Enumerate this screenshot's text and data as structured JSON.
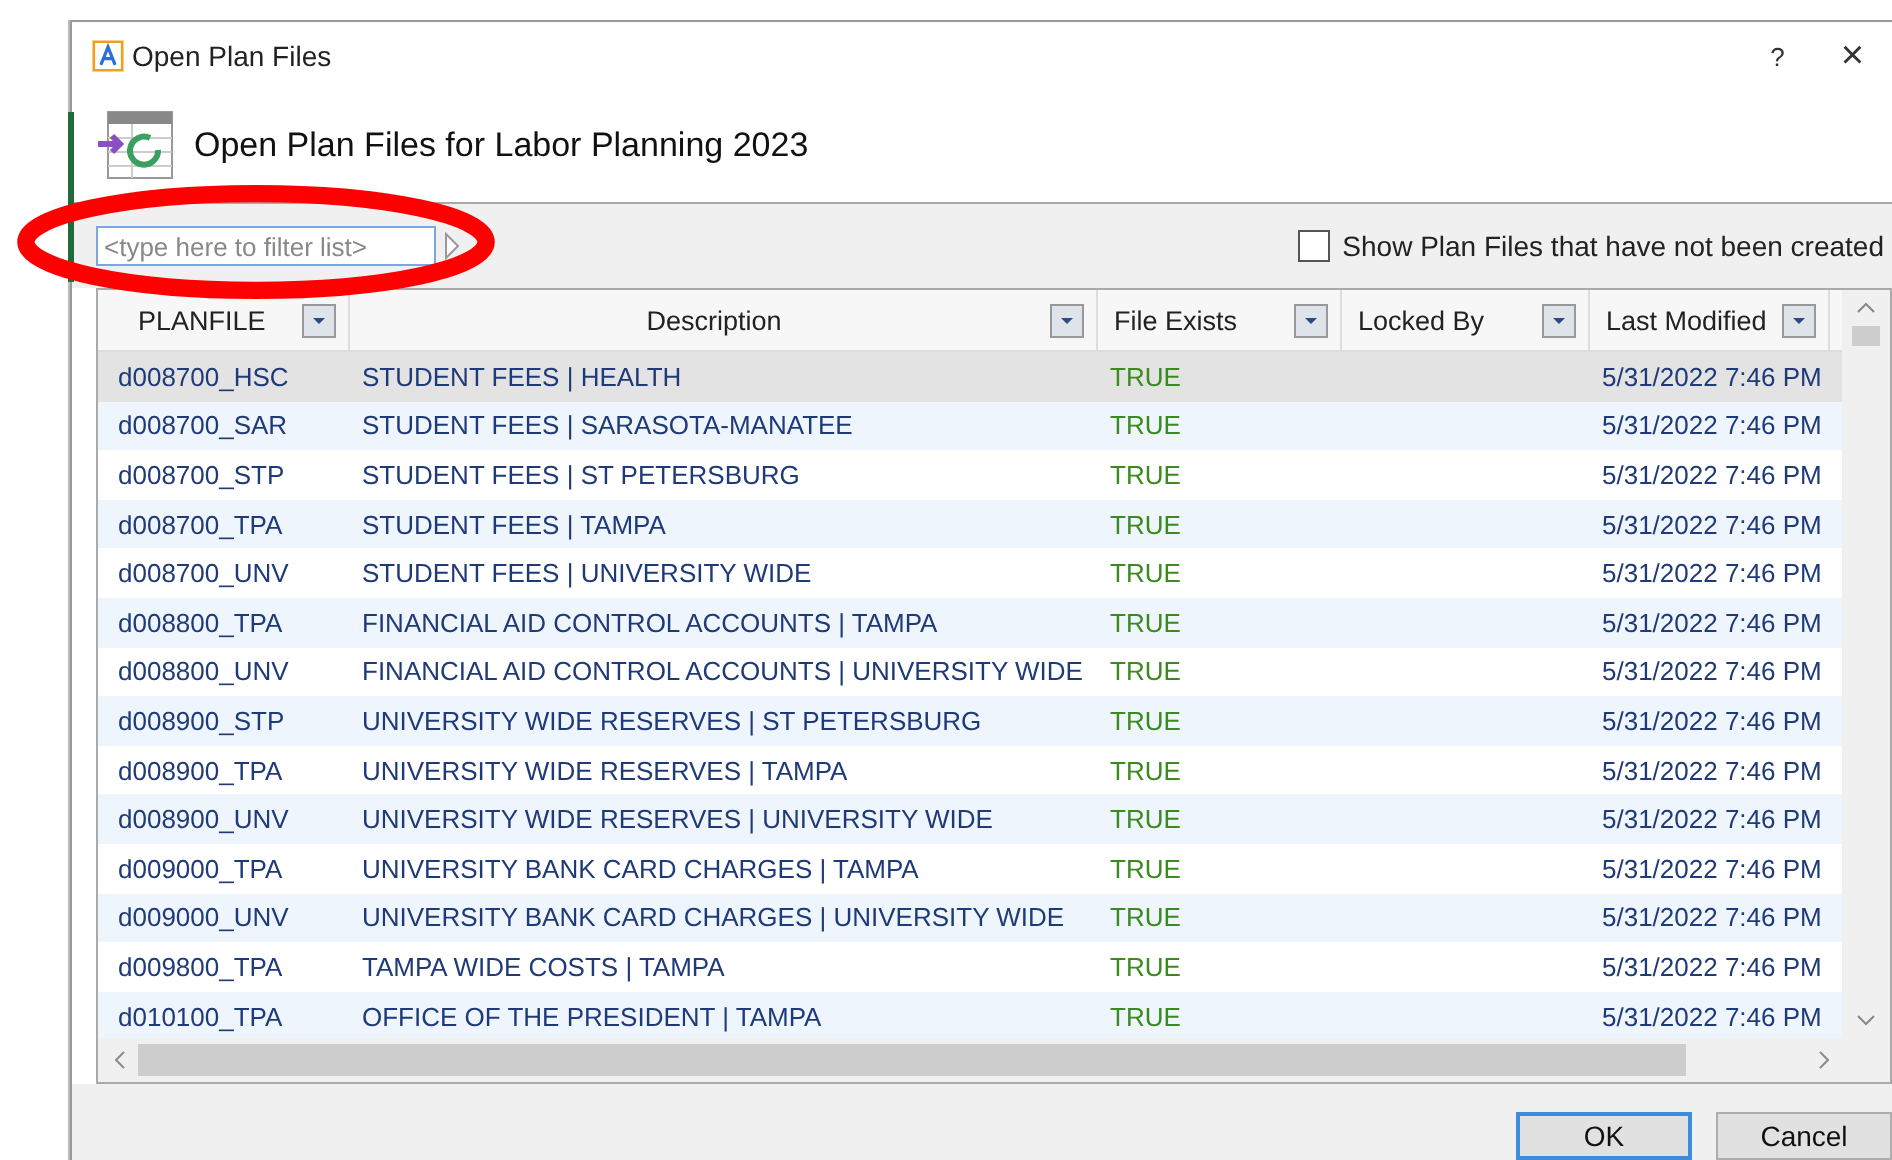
{
  "window": {
    "title": "Open Plan Files",
    "help": "?",
    "close": "×"
  },
  "header": {
    "title": "Open Plan Files for Labor Planning 2023"
  },
  "filter": {
    "placeholder": "<type here to filter list>"
  },
  "show_uncreated": {
    "label": "Show Plan Files that have not been created",
    "checked": false
  },
  "table": {
    "columns": [
      "PLANFILE",
      "Description",
      "File Exists",
      "Locked By",
      "Last Modified"
    ],
    "rows": [
      {
        "planfile": "d008700_HSC",
        "description": "STUDENT FEES | HEALTH",
        "exists": "TRUE",
        "modified": "5/31/2022 7:46 PM",
        "selected": true
      },
      {
        "planfile": "d008700_SAR",
        "description": "STUDENT FEES | SARASOTA-MANATEE",
        "exists": "TRUE",
        "modified": "5/31/2022 7:46 PM",
        "selected": false
      },
      {
        "planfile": "d008700_STP",
        "description": "STUDENT FEES | ST PETERSBURG",
        "exists": "TRUE",
        "modified": "5/31/2022 7:46 PM",
        "selected": false
      },
      {
        "planfile": "d008700_TPA",
        "description": "STUDENT FEES | TAMPA",
        "exists": "TRUE",
        "modified": "5/31/2022 7:46 PM",
        "selected": false
      },
      {
        "planfile": "d008700_UNV",
        "description": "STUDENT FEES | UNIVERSITY WIDE",
        "exists": "TRUE",
        "modified": "5/31/2022 7:46 PM",
        "selected": false
      },
      {
        "planfile": "d008800_TPA",
        "description": "FINANCIAL AID CONTROL ACCOUNTS | TAMPA",
        "exists": "TRUE",
        "modified": "5/31/2022 7:46 PM",
        "selected": false
      },
      {
        "planfile": "d008800_UNV",
        "description": "FINANCIAL AID CONTROL ACCOUNTS | UNIVERSITY WIDE",
        "exists": "TRUE",
        "modified": "5/31/2022 7:46 PM",
        "selected": false
      },
      {
        "planfile": "d008900_STP",
        "description": "UNIVERSITY WIDE RESERVES | ST PETERSBURG",
        "exists": "TRUE",
        "modified": "5/31/2022 7:46 PM",
        "selected": false
      },
      {
        "planfile": "d008900_TPA",
        "description": "UNIVERSITY WIDE RESERVES | TAMPA",
        "exists": "TRUE",
        "modified": "5/31/2022 7:46 PM",
        "selected": false
      },
      {
        "planfile": "d008900_UNV",
        "description": "UNIVERSITY WIDE RESERVES | UNIVERSITY WIDE",
        "exists": "TRUE",
        "modified": "5/31/2022 7:46 PM",
        "selected": false
      },
      {
        "planfile": "d009000_TPA",
        "description": "UNIVERSITY BANK CARD CHARGES | TAMPA",
        "exists": "TRUE",
        "modified": "5/31/2022 7:46 PM",
        "selected": false
      },
      {
        "planfile": "d009000_UNV",
        "description": "UNIVERSITY BANK CARD CHARGES | UNIVERSITY WIDE",
        "exists": "TRUE",
        "modified": "5/31/2022 7:46 PM",
        "selected": false
      },
      {
        "planfile": "d009800_TPA",
        "description": "TAMPA WIDE COSTS | TAMPA",
        "exists": "TRUE",
        "modified": "5/31/2022 7:46 PM",
        "selected": false
      },
      {
        "planfile": "d010100_TPA",
        "description": "OFFICE OF THE PRESIDENT | TAMPA",
        "exists": "TRUE",
        "modified": "5/31/2022 7:46 PM",
        "selected": false
      }
    ]
  },
  "buttons": [
    "OK",
    "Cancel"
  ]
}
